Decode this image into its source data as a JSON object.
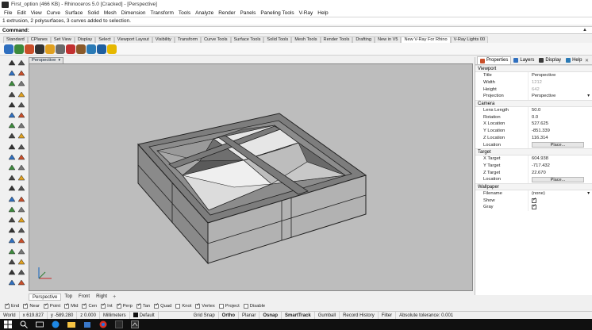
{
  "window": {
    "title": "First_option (466 KB) - Rhinoceros 5.0 [Cracked] - [Perspective]"
  },
  "menu": [
    "File",
    "Edit",
    "View",
    "Curve",
    "Surface",
    "Solid",
    "Mesh",
    "Dimension",
    "Transform",
    "Tools",
    "Analyze",
    "Render",
    "Panels",
    "Paneling Tools",
    "V-Ray",
    "Help"
  ],
  "command_history": "1 extrusion, 2 polysurfaces, 3 curves added to selection.",
  "command": {
    "label": "Command:"
  },
  "toolbar_tabs": [
    {
      "label": "Standard",
      "active": false
    },
    {
      "label": "CPlanes",
      "active": false
    },
    {
      "label": "Set View",
      "active": false
    },
    {
      "label": "Display",
      "active": false
    },
    {
      "label": "Select",
      "active": false
    },
    {
      "label": "Viewport Layout",
      "active": false
    },
    {
      "label": "Visibility",
      "active": false
    },
    {
      "label": "Transform",
      "active": false
    },
    {
      "label": "Curve Tools",
      "active": false
    },
    {
      "label": "Surface Tools",
      "active": false
    },
    {
      "label": "Solid Tools",
      "active": false
    },
    {
      "label": "Mesh Tools",
      "active": false
    },
    {
      "label": "Render Tools",
      "active": false
    },
    {
      "label": "Drafting",
      "active": false
    },
    {
      "label": "New in V5",
      "active": false
    },
    {
      "label": "New V-Ray For Rhino",
      "active": true
    },
    {
      "label": "V-Ray Lights 00",
      "active": false
    }
  ],
  "vray_toolbar_icons": [
    {
      "name": "vray-render-icon",
      "color": "#2f6fbf"
    },
    {
      "name": "vray-options-icon",
      "color": "#3c8a3c"
    },
    {
      "name": "vray-material-editor-icon",
      "color": "#c94f2a"
    },
    {
      "name": "vray-frame-buffer-icon",
      "color": "#333333"
    },
    {
      "name": "vray-sun-icon",
      "color": "#e0a020"
    },
    {
      "name": "vray-proxy-icon",
      "color": "#6a6a6a"
    },
    {
      "name": "vray-rt-icon",
      "color": "#c23030"
    },
    {
      "name": "vray-fur-icon",
      "color": "#8a5a2a"
    },
    {
      "name": "vray-dome-icon",
      "color": "#2a7ab5"
    },
    {
      "name": "vray-help-icon",
      "color": "#1f5fa0"
    },
    {
      "name": "vray-info-icon",
      "color": "#e6b800"
    }
  ],
  "viewport": {
    "name": "Perspective",
    "tabs": [
      {
        "label": "Perspective",
        "active": true
      },
      {
        "label": "Top",
        "active": false
      },
      {
        "label": "Front",
        "active": false
      },
      {
        "label": "Right",
        "active": false
      }
    ],
    "add_tab": "+",
    "background": "#bdbdbd"
  },
  "panel": {
    "tabs": [
      {
        "label": "Properties",
        "active": true,
        "icon_color": "#c94f2a"
      },
      {
        "label": "Layers",
        "active": false,
        "icon_color": "#2f6fbf"
      },
      {
        "label": "Display",
        "active": false,
        "icon_color": "#3a3a3a"
      },
      {
        "label": "Help",
        "active": false,
        "icon_color": "#2a7ab5"
      }
    ],
    "sections": [
      {
        "title": "Viewport",
        "rows": [
          {
            "label": "Title",
            "value": "Perspective",
            "kind": "text"
          },
          {
            "label": "Width",
            "value": "1212",
            "kind": "dim"
          },
          {
            "label": "Height",
            "value": "642",
            "kind": "dim"
          },
          {
            "label": "Projection",
            "value": "Perspective",
            "kind": "dropdown"
          }
        ]
      },
      {
        "title": "Camera",
        "rows": [
          {
            "label": "Lens Length",
            "value": "50.0",
            "kind": "text"
          },
          {
            "label": "Rotation",
            "value": "0.0",
            "kind": "text"
          },
          {
            "label": "X Location",
            "value": "527.625",
            "kind": "text"
          },
          {
            "label": "Y Location",
            "value": "-851.339",
            "kind": "text"
          },
          {
            "label": "Z Location",
            "value": "116.314",
            "kind": "text"
          },
          {
            "label": "Location",
            "value": "Place...",
            "kind": "button"
          }
        ]
      },
      {
        "title": "Target",
        "rows": [
          {
            "label": "X Target",
            "value": "604.938",
            "kind": "text"
          },
          {
            "label": "Y Target",
            "value": "-717.432",
            "kind": "text"
          },
          {
            "label": "Z Target",
            "value": "22.670",
            "kind": "text"
          },
          {
            "label": "Location",
            "value": "Place...",
            "kind": "button"
          }
        ]
      },
      {
        "title": "Wallpaper",
        "rows": [
          {
            "label": "Filename",
            "value": "(none)",
            "kind": "dropdown"
          },
          {
            "label": "Show",
            "value": "",
            "kind": "check"
          },
          {
            "label": "Gray",
            "value": "",
            "kind": "check"
          }
        ]
      }
    ]
  },
  "osnaps": [
    {
      "label": "End",
      "checked": true
    },
    {
      "label": "Near",
      "checked": true
    },
    {
      "label": "Point",
      "checked": true
    },
    {
      "label": "Mid",
      "checked": true
    },
    {
      "label": "Cen",
      "checked": true
    },
    {
      "label": "Int",
      "checked": true
    },
    {
      "label": "Perp",
      "checked": true
    },
    {
      "label": "Tan",
      "checked": true
    },
    {
      "label": "Quad",
      "checked": true
    },
    {
      "label": "Knot",
      "checked": false
    },
    {
      "label": "Vertex",
      "checked": true
    },
    {
      "label": "Project",
      "checked": false
    },
    {
      "label": "Disable",
      "checked": false
    }
  ],
  "status": {
    "cplane": "World",
    "x": "x 619.827",
    "y": "y -589.280",
    "z": "z 0.000",
    "units": "Millimeters",
    "layer": "Default",
    "grid_snap": "Grid Snap",
    "ortho": "Ortho",
    "planar": "Planar",
    "osnap": "Osnap",
    "smarttrack": "SmartTrack",
    "gumball": "Gumball",
    "record_history": "Record History",
    "filter": "Filter",
    "tolerance": "Absolute tolerance: 0.001"
  }
}
